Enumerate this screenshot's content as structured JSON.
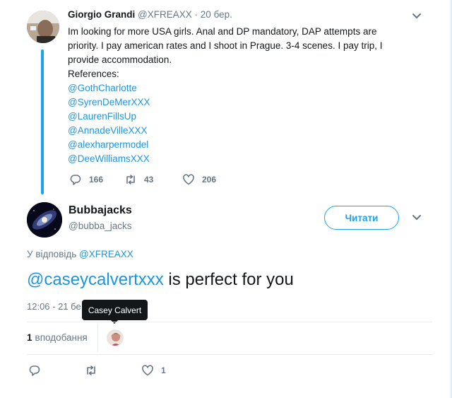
{
  "parent_tweet": {
    "name": "Giorgio Grandi",
    "handle": "@XFREAXX",
    "separator": "·",
    "date": "20 бер.",
    "body_lines": [
      "Im looking for more USA girls. Anal and DP mandatory, DAP attempts are",
      "priority. I pay american rates and I shoot in Prague. 3-4 scenes. I pay trip, I",
      "provide accommodation.",
      "References:"
    ],
    "references": [
      "@GothCharlotte",
      "@SyrenDeMerXXX",
      "@LaurenFillsUp",
      "@AnnadeVilleXXX",
      "@alexharpermodel",
      "@DeeWilliamsXXX"
    ],
    "actions": {
      "reply_count": "166",
      "retweet_count": "43",
      "like_count": "206"
    }
  },
  "main_tweet": {
    "name": "Bubbajacks",
    "handle": "@bubba_jacks",
    "follow_label": "Читати",
    "reply_to_prefix": "У відповідь",
    "reply_to_handle": "@XFREAXX",
    "mention": "@caseycalvertxxx",
    "text_rest": " is perfect for you",
    "timestamp": "12:06 - 21 бе",
    "tooltip": "Casey Calvert",
    "likes_count": "1",
    "likes_label": "вподобання",
    "actions": {
      "like_count": "1"
    }
  },
  "colors": {
    "accent": "#1da1f2",
    "link": "#1b95e0",
    "muted": "#657786",
    "text": "#14171a"
  }
}
